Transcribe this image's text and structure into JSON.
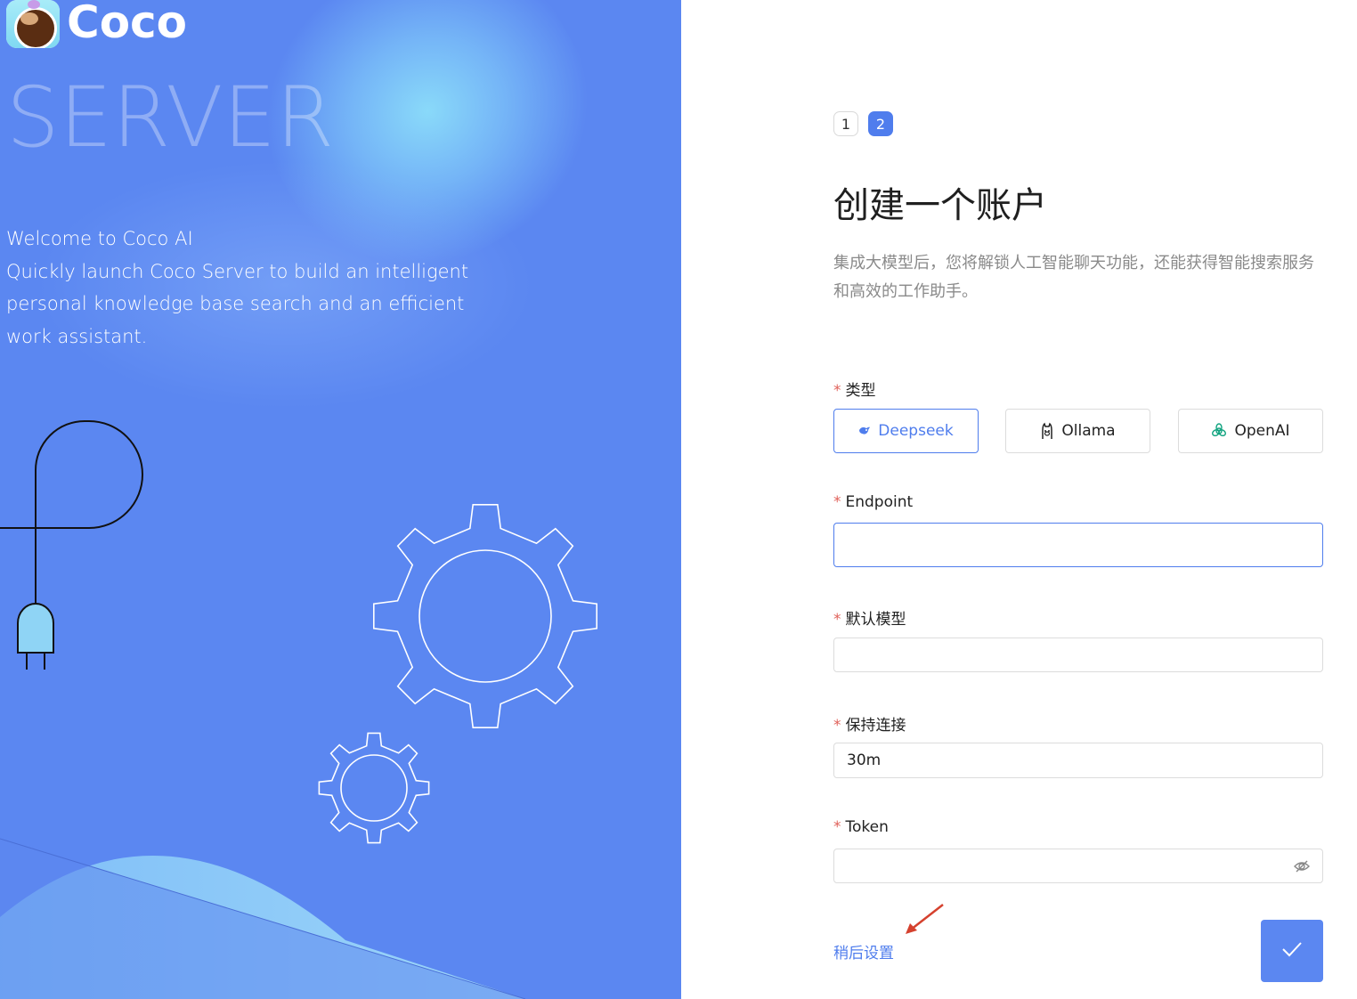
{
  "brand": {
    "name": "Coco",
    "hero_word": "SERVER"
  },
  "welcome": {
    "lines": [
      "Welcome to Coco AI",
      "Quickly launch Coco Server to build an intelligent",
      "personal knowledge base search and an efficient",
      "work assistant."
    ]
  },
  "steps": [
    "1",
    "2"
  ],
  "form": {
    "title": "创建一个账户",
    "description": "集成大模型后，您将解锁人工智能聊天功能，还能获得智能搜索服务和高效的工作助手。",
    "required_mark": "*",
    "type_label": "类型",
    "types": [
      {
        "label": "Deepseek",
        "icon": "deepseek-icon",
        "selected": true
      },
      {
        "label": "Ollama",
        "icon": "ollama-icon",
        "selected": false
      },
      {
        "label": "OpenAI",
        "icon": "openai-icon",
        "selected": false
      }
    ],
    "endpoint_label": "Endpoint",
    "endpoint_value": "",
    "model_label": "默认模型",
    "model_value": "",
    "keepalive_label": "保持连接",
    "keepalive_value": "30m",
    "token_label": "Token",
    "token_value": "",
    "skip_label": "稍后设置",
    "confirm_icon": "check-icon"
  },
  "colors": {
    "left_bg": "#5b87f1",
    "accent": "#4f7ded",
    "required": "#e0615a",
    "annotation_arrow": "#d5412e"
  }
}
